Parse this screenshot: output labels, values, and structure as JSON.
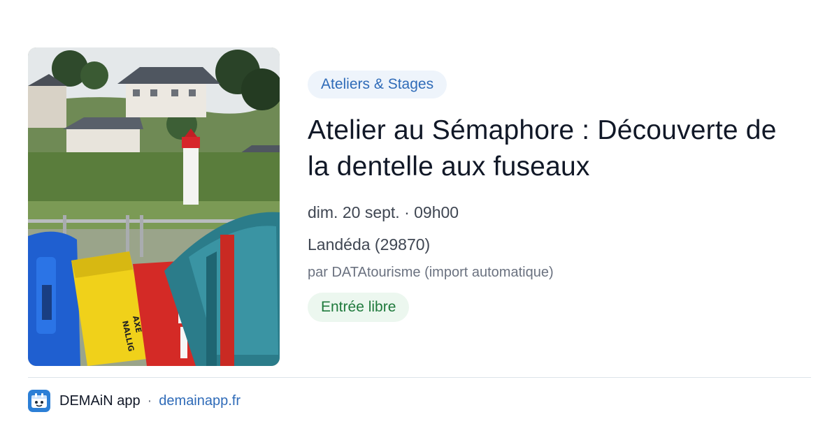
{
  "card": {
    "image_icon": "event-photo",
    "image_text": [
      "AXE",
      "NALLIG"
    ],
    "category": "Ateliers & Stages",
    "title": "Atelier au Sémaphore : Découverte de la dentelle aux fuseaux",
    "datetime": "dim. 20 sept. · 09h00",
    "location": "Landéda (29870)",
    "author": "par DATAtourisme (import automatique)",
    "price": "Entrée libre"
  },
  "footer": {
    "logo_icon": "app-logo-icon",
    "app_name": "DEMAiN app",
    "separator": "·",
    "url": "demainapp.fr"
  },
  "colors": {
    "category_bg": "#eef4fb",
    "category_text": "#2f6bb8",
    "price_bg": "#ecf7ef",
    "price_text": "#1f7a3c",
    "link": "#2f6bb8",
    "logo_bg": "#2c7fd6"
  }
}
